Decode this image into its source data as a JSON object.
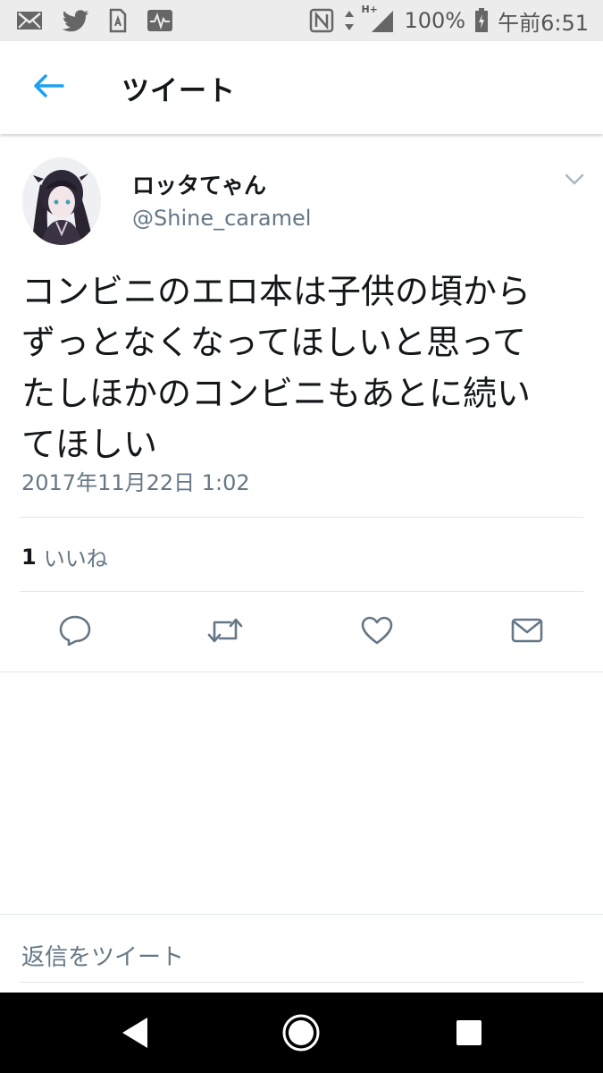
{
  "status_bar": {
    "battery": "100%",
    "time": "午前6:51",
    "network": "H+",
    "icons": [
      "mail-icon",
      "twitter-bird-icon",
      "sim-icon",
      "activity-icon",
      "nfc-icon",
      "data-arrows-icon",
      "signal-icon",
      "battery-icon"
    ]
  },
  "header": {
    "title": "ツイート",
    "back_icon": "arrow-left-icon"
  },
  "tweet": {
    "author_name": "ロッタてゃん",
    "author_handle": "@Shine_caramel",
    "text": "コンビニのエロ本は子供の頃から\nずっとなくなってほしいと思って\nたしほかのコンビニもあとに続い\nてほしい",
    "timestamp": "2017年11月22日 1:02",
    "likes_count": "1",
    "likes_label": "いいね"
  },
  "actions": [
    "reply-icon",
    "retweet-icon",
    "like-icon",
    "share-icon"
  ],
  "reply_bar": {
    "placeholder": "返信をツイート"
  },
  "colors": {
    "accent": "#1da1f2",
    "text": "#14171a",
    "secondary": "#657786",
    "divider": "#e1e8ed",
    "status_bar": "#ececec",
    "nav_bar": "#000000"
  }
}
